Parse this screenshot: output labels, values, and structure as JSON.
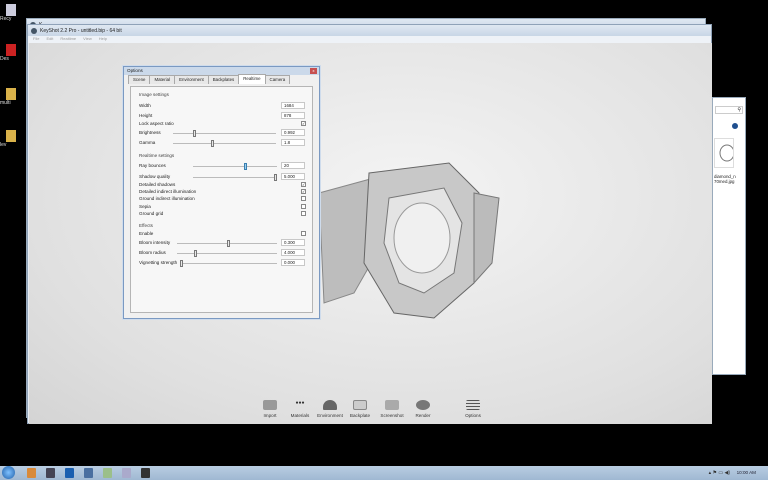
{
  "desktop": {
    "icons": [
      {
        "label": "Recy"
      },
      {
        "label": "Des"
      },
      {
        "label": "multi"
      },
      {
        "label": "lev"
      }
    ]
  },
  "background_window": {
    "title": "K"
  },
  "app": {
    "title": "KeyShot 2.2 Pro - untitled.bip - 64 bit",
    "menu": [
      "File",
      "Edit",
      "Realtime",
      "View",
      "Help"
    ],
    "toolbar": [
      {
        "label": "Import",
        "icon": "import-icon"
      },
      {
        "label": "Materials",
        "icon": "materials-icon"
      },
      {
        "label": "Environment",
        "icon": "environment-icon"
      },
      {
        "label": "Backplate",
        "icon": "backplate-icon"
      },
      {
        "label": "Screenshot",
        "icon": "screenshot-icon"
      },
      {
        "label": "Render",
        "icon": "teapot-icon"
      },
      {
        "label": "Options",
        "icon": "options-icon"
      }
    ]
  },
  "explorer": {
    "file_label_1": "diamond_n",
    "file_label_2": "70med.jpg"
  },
  "options": {
    "title": "Options",
    "close": "x",
    "tabs": [
      "Scene",
      "Material",
      "Environment",
      "Backplates",
      "Realtime",
      "Camera"
    ],
    "active_tab": "Realtime",
    "image_settings": {
      "heading": "Image settings",
      "width_label": "Width",
      "width": "1684",
      "height_label": "Height",
      "height": "878",
      "lock_label": "Lock aspect ratio",
      "lock": true,
      "brightness_label": "Brightness",
      "brightness": "0.992",
      "brightness_pos": 0.2,
      "gamma_label": "Gamma",
      "gamma": "1.8",
      "gamma_pos": 0.38
    },
    "realtime_settings": {
      "heading": "Realtime settings",
      "ray_bounces_label": "Ray bounces",
      "ray_bounces": "20",
      "ray_bounces_pos": 0.63,
      "shadow_quality_label": "Shadow quality",
      "shadow_quality": "5.000",
      "shadow_quality_pos": 1.0,
      "checks": [
        {
          "label": "Detailed shadows",
          "checked": true
        },
        {
          "label": "Detailed indirect illumination",
          "checked": true
        },
        {
          "label": "Ground indirect illumination",
          "checked": false
        },
        {
          "label": "Sepia",
          "checked": false
        },
        {
          "label": "Ground grid",
          "checked": false
        }
      ]
    },
    "effects": {
      "heading": "Effects",
      "enable_label": "Enable",
      "enable": false,
      "bloom_intensity_label": "Bloom intensity",
      "bloom_intensity": "0.300",
      "bloom_intensity_pos": 0.52,
      "bloom_radius_label": "Bloom radius",
      "bloom_radius": "4.000",
      "bloom_radius_pos": 0.18,
      "vignetting_label": "Vignetting strength",
      "vignetting": "0.000",
      "vignetting_pos": 0.0
    }
  },
  "taskbar": {
    "clock": "10:00 AM",
    "tray": "▴ ⚑ ▭ ◀)"
  }
}
